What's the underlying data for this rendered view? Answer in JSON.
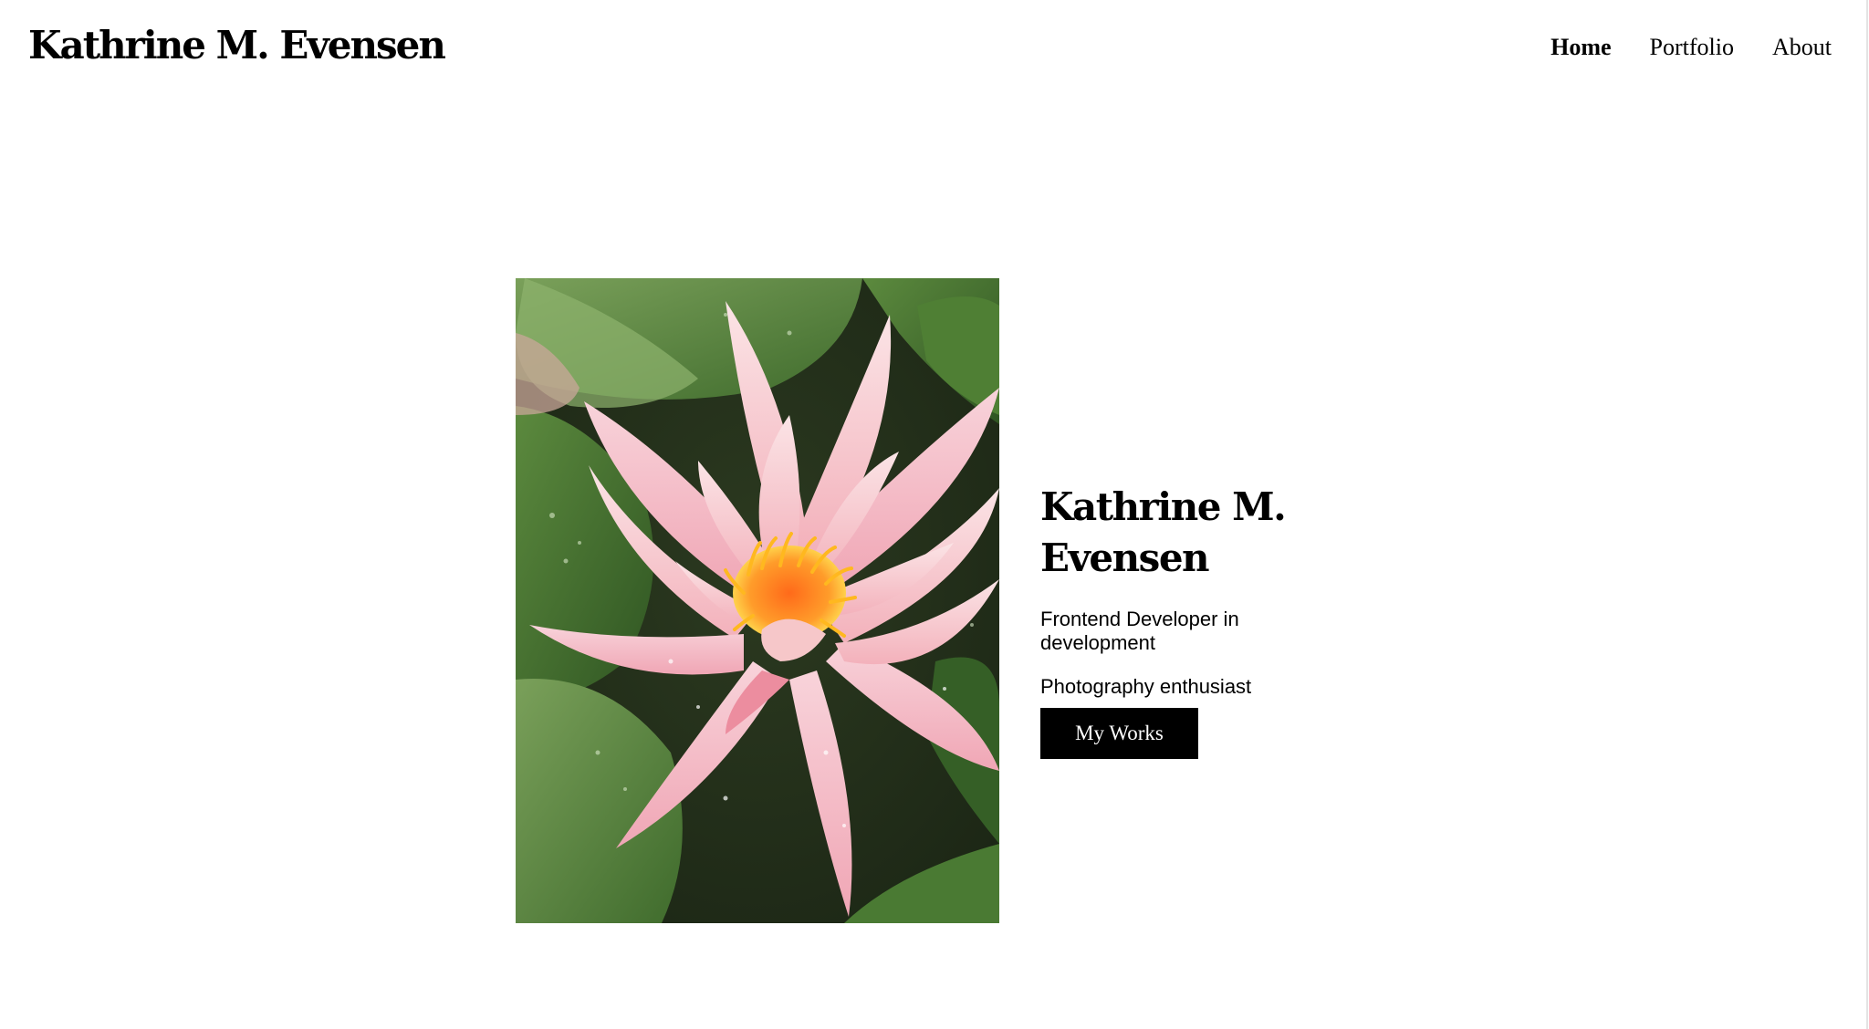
{
  "header": {
    "brand": "Kathrine M. Evensen",
    "nav": [
      {
        "label": "Home",
        "active": true
      },
      {
        "label": "Portfolio",
        "active": false
      },
      {
        "label": "About",
        "active": false
      }
    ]
  },
  "hero": {
    "name": "Kathrine M. Evensen",
    "role": "Frontend Developer in development",
    "hobby": "Photography enthusiast",
    "button_label": "My Works"
  },
  "colors": {
    "background": "#ffffff",
    "text": "#000000",
    "button_bg": "#000000",
    "button_text": "#ffffff"
  }
}
